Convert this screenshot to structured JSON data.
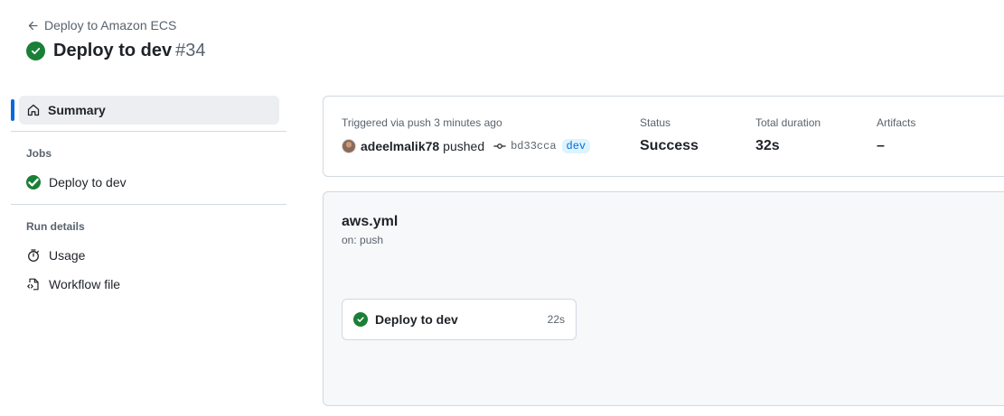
{
  "header": {
    "back_link": "Deploy to Amazon ECS",
    "title": "Deploy to dev",
    "run_number": "#34"
  },
  "sidebar": {
    "summary_label": "Summary",
    "jobs_heading": "Jobs",
    "jobs": [
      {
        "label": "Deploy to dev",
        "status": "success"
      }
    ],
    "run_details_heading": "Run details",
    "usage_label": "Usage",
    "workflow_file_label": "Workflow file"
  },
  "summary": {
    "trigger_text": "Triggered via push 3 minutes ago",
    "username": "adeelmalik78",
    "action": "pushed",
    "commit_sha": "bd33cca",
    "branch": "dev",
    "status_label": "Status",
    "status_value": "Success",
    "duration_label": "Total duration",
    "duration_value": "32s",
    "artifacts_label": "Artifacts",
    "artifacts_value": "–"
  },
  "workflow": {
    "file_name": "aws.yml",
    "trigger": "on: push",
    "job": {
      "name": "Deploy to dev",
      "duration": "22s",
      "status": "success"
    }
  },
  "colors": {
    "success": "#1a7f37",
    "accent": "#0969da",
    "muted_text": "#59636e",
    "border": "#d1d9e0"
  },
  "icons": [
    "arrow-left-icon",
    "check-circle-icon",
    "home-icon",
    "stopwatch-icon",
    "file-code-icon",
    "git-commit-icon"
  ]
}
